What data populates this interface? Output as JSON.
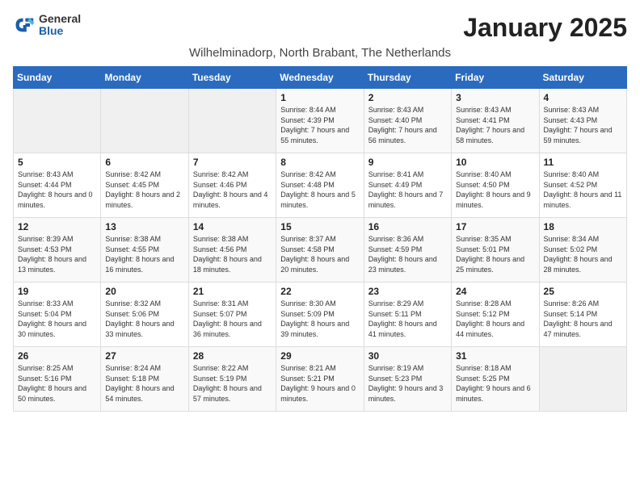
{
  "logo": {
    "general": "General",
    "blue": "Blue"
  },
  "title": "January 2025",
  "subtitle": "Wilhelminadorp, North Brabant, The Netherlands",
  "header": {
    "days": [
      "Sunday",
      "Monday",
      "Tuesday",
      "Wednesday",
      "Thursday",
      "Friday",
      "Saturday"
    ]
  },
  "weeks": [
    {
      "cells": [
        {
          "empty": true
        },
        {
          "empty": true
        },
        {
          "empty": true
        },
        {
          "day": 1,
          "sunrise": "8:44 AM",
          "sunset": "4:39 PM",
          "daylight": "Daylight: 7 hours and 55 minutes."
        },
        {
          "day": 2,
          "sunrise": "8:43 AM",
          "sunset": "4:40 PM",
          "daylight": "Daylight: 7 hours and 56 minutes."
        },
        {
          "day": 3,
          "sunrise": "8:43 AM",
          "sunset": "4:41 PM",
          "daylight": "Daylight: 7 hours and 58 minutes."
        },
        {
          "day": 4,
          "sunrise": "8:43 AM",
          "sunset": "4:43 PM",
          "daylight": "Daylight: 7 hours and 59 minutes."
        }
      ]
    },
    {
      "cells": [
        {
          "day": 5,
          "sunrise": "8:43 AM",
          "sunset": "4:44 PM",
          "daylight": "Daylight: 8 hours and 0 minutes."
        },
        {
          "day": 6,
          "sunrise": "8:42 AM",
          "sunset": "4:45 PM",
          "daylight": "Daylight: 8 hours and 2 minutes."
        },
        {
          "day": 7,
          "sunrise": "8:42 AM",
          "sunset": "4:46 PM",
          "daylight": "Daylight: 8 hours and 4 minutes."
        },
        {
          "day": 8,
          "sunrise": "8:42 AM",
          "sunset": "4:48 PM",
          "daylight": "Daylight: 8 hours and 5 minutes."
        },
        {
          "day": 9,
          "sunrise": "8:41 AM",
          "sunset": "4:49 PM",
          "daylight": "Daylight: 8 hours and 7 minutes."
        },
        {
          "day": 10,
          "sunrise": "8:40 AM",
          "sunset": "4:50 PM",
          "daylight": "Daylight: 8 hours and 9 minutes."
        },
        {
          "day": 11,
          "sunrise": "8:40 AM",
          "sunset": "4:52 PM",
          "daylight": "Daylight: 8 hours and 11 minutes."
        }
      ]
    },
    {
      "cells": [
        {
          "day": 12,
          "sunrise": "8:39 AM",
          "sunset": "4:53 PM",
          "daylight": "Daylight: 8 hours and 13 minutes."
        },
        {
          "day": 13,
          "sunrise": "8:38 AM",
          "sunset": "4:55 PM",
          "daylight": "Daylight: 8 hours and 16 minutes."
        },
        {
          "day": 14,
          "sunrise": "8:38 AM",
          "sunset": "4:56 PM",
          "daylight": "Daylight: 8 hours and 18 minutes."
        },
        {
          "day": 15,
          "sunrise": "8:37 AM",
          "sunset": "4:58 PM",
          "daylight": "Daylight: 8 hours and 20 minutes."
        },
        {
          "day": 16,
          "sunrise": "8:36 AM",
          "sunset": "4:59 PM",
          "daylight": "Daylight: 8 hours and 23 minutes."
        },
        {
          "day": 17,
          "sunrise": "8:35 AM",
          "sunset": "5:01 PM",
          "daylight": "Daylight: 8 hours and 25 minutes."
        },
        {
          "day": 18,
          "sunrise": "8:34 AM",
          "sunset": "5:02 PM",
          "daylight": "Daylight: 8 hours and 28 minutes."
        }
      ]
    },
    {
      "cells": [
        {
          "day": 19,
          "sunrise": "8:33 AM",
          "sunset": "5:04 PM",
          "daylight": "Daylight: 8 hours and 30 minutes."
        },
        {
          "day": 20,
          "sunrise": "8:32 AM",
          "sunset": "5:06 PM",
          "daylight": "Daylight: 8 hours and 33 minutes."
        },
        {
          "day": 21,
          "sunrise": "8:31 AM",
          "sunset": "5:07 PM",
          "daylight": "Daylight: 8 hours and 36 minutes."
        },
        {
          "day": 22,
          "sunrise": "8:30 AM",
          "sunset": "5:09 PM",
          "daylight": "Daylight: 8 hours and 39 minutes."
        },
        {
          "day": 23,
          "sunrise": "8:29 AM",
          "sunset": "5:11 PM",
          "daylight": "Daylight: 8 hours and 41 minutes."
        },
        {
          "day": 24,
          "sunrise": "8:28 AM",
          "sunset": "5:12 PM",
          "daylight": "Daylight: 8 hours and 44 minutes."
        },
        {
          "day": 25,
          "sunrise": "8:26 AM",
          "sunset": "5:14 PM",
          "daylight": "Daylight: 8 hours and 47 minutes."
        }
      ]
    },
    {
      "cells": [
        {
          "day": 26,
          "sunrise": "8:25 AM",
          "sunset": "5:16 PM",
          "daylight": "Daylight: 8 hours and 50 minutes."
        },
        {
          "day": 27,
          "sunrise": "8:24 AM",
          "sunset": "5:18 PM",
          "daylight": "Daylight: 8 hours and 54 minutes."
        },
        {
          "day": 28,
          "sunrise": "8:22 AM",
          "sunset": "5:19 PM",
          "daylight": "Daylight: 8 hours and 57 minutes."
        },
        {
          "day": 29,
          "sunrise": "8:21 AM",
          "sunset": "5:21 PM",
          "daylight": "Daylight: 9 hours and 0 minutes."
        },
        {
          "day": 30,
          "sunrise": "8:19 AM",
          "sunset": "5:23 PM",
          "daylight": "Daylight: 9 hours and 3 minutes."
        },
        {
          "day": 31,
          "sunrise": "8:18 AM",
          "sunset": "5:25 PM",
          "daylight": "Daylight: 9 hours and 6 minutes."
        },
        {
          "empty": true
        }
      ]
    }
  ]
}
